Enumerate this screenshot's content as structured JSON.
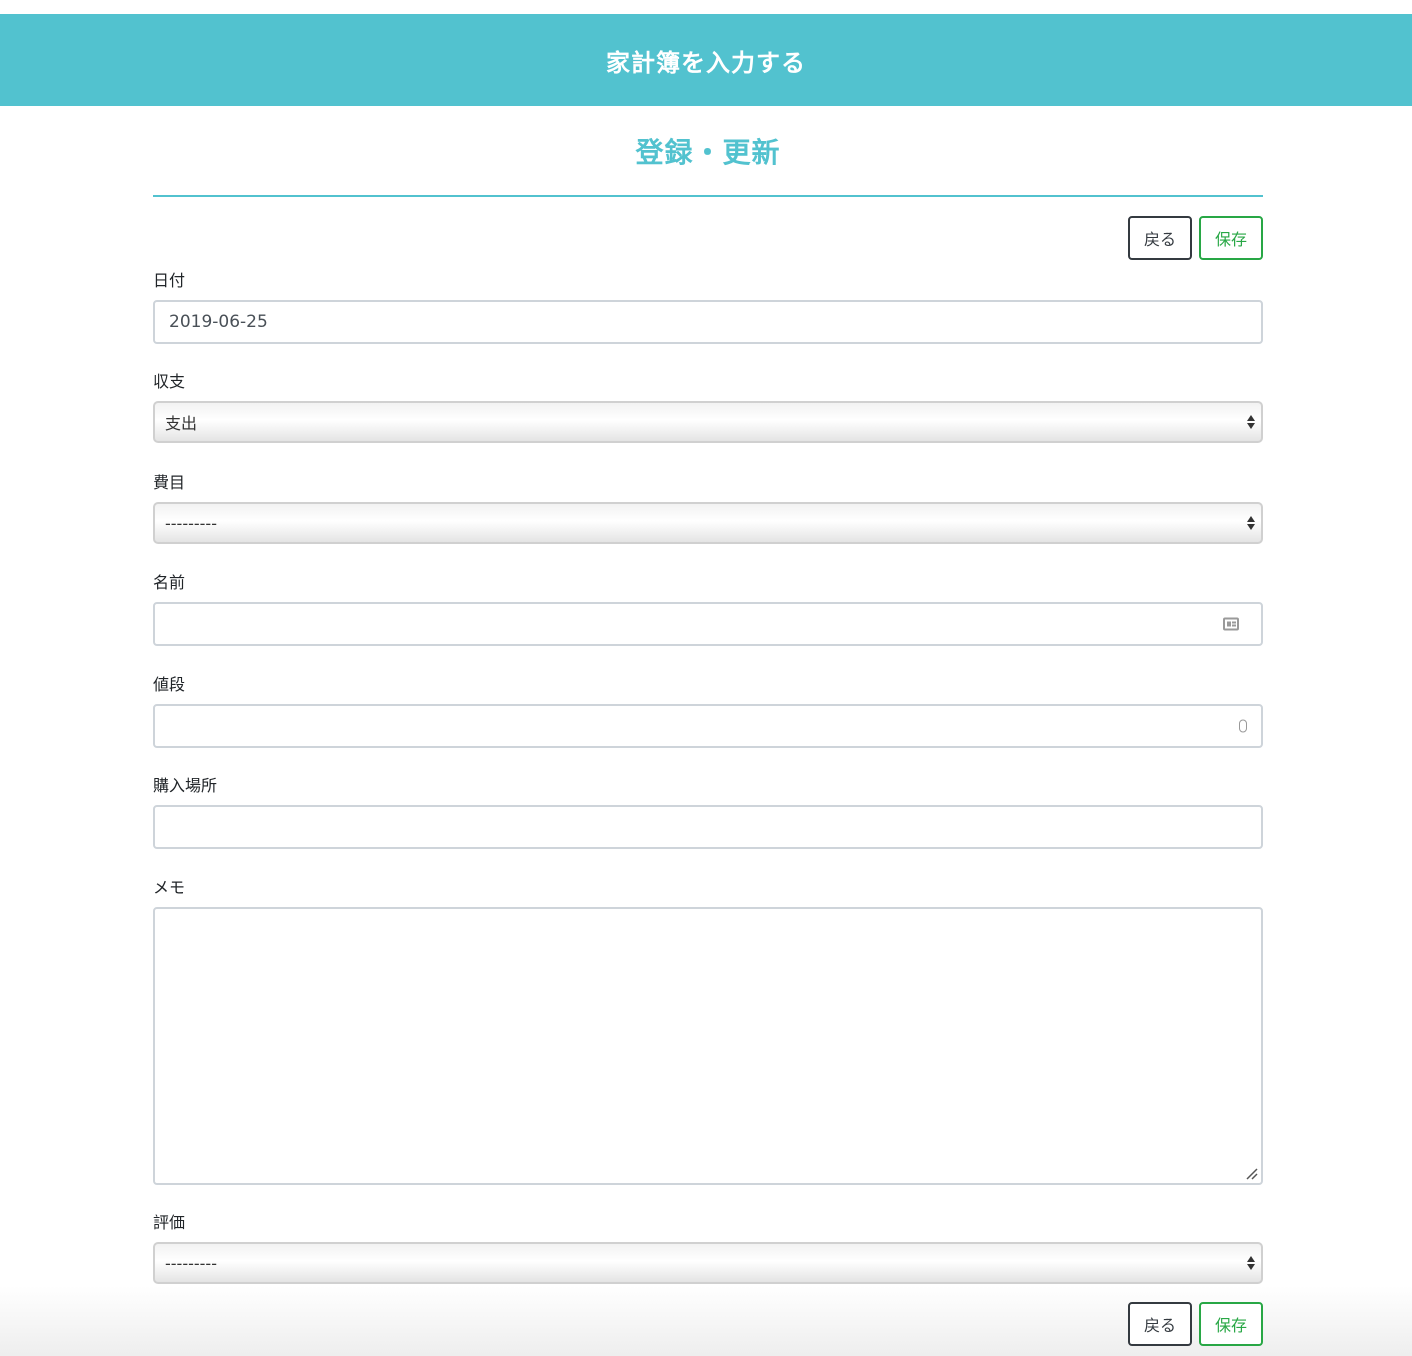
{
  "header": {
    "title": "家計簿を入力する"
  },
  "section": {
    "title": "登録・更新"
  },
  "buttons": {
    "back_label": "戻る",
    "save_label": "保存"
  },
  "form": {
    "date": {
      "label": "日付",
      "value": "2019-06-25"
    },
    "income_expense": {
      "label": "収支",
      "selected": "支出"
    },
    "category": {
      "label": "費目",
      "selected": "---------"
    },
    "name": {
      "label": "名前",
      "value": ""
    },
    "price": {
      "label": "値段",
      "value": ""
    },
    "place": {
      "label": "購入場所",
      "value": ""
    },
    "memo": {
      "label": "メモ",
      "value": ""
    },
    "rating": {
      "label": "評価",
      "selected": "---------"
    }
  },
  "colors": {
    "accent": "#52c2cf",
    "save": "#28a745",
    "back": "#343a40"
  }
}
